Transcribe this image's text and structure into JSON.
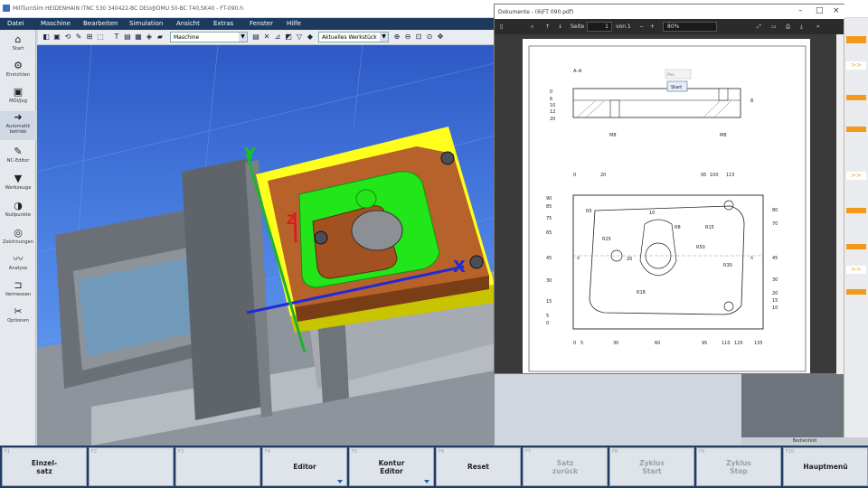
{
  "window_title": "MillTurnSim HEIDENHAIN iTNC 530 340422-BC DEU@DMU 50-BC T40,SK40 - FT-090.h",
  "menu": [
    "Datei",
    "Maschine",
    "Bearbeiten",
    "Simulation",
    "Ansicht",
    "Extras",
    "Fenster",
    "Hilfe"
  ],
  "toolbar": {
    "view_combo": "Maschine",
    "workpiece_combo": "Aktuelles Werkstück"
  },
  "sidebar": [
    {
      "label": "Start",
      "icon": "home-icon"
    },
    {
      "label": "Einrichten",
      "icon": "setup-icon"
    },
    {
      "label": "MDI/Jog",
      "icon": "mdi-jog-icon"
    },
    {
      "label": "Automatik betrieb",
      "icon": "automatic-mode-icon"
    },
    {
      "label": "NC-Editor",
      "icon": "nc-editor-icon"
    },
    {
      "label": "Werkzeuge",
      "icon": "tools-icon"
    },
    {
      "label": "Nullpunkte",
      "icon": "datum-icon"
    },
    {
      "label": "Zeichnungen",
      "icon": "drawings-icon"
    },
    {
      "label": "Analyse",
      "icon": "analysis-icon"
    },
    {
      "label": "Vermessen",
      "icon": "measure-icon"
    },
    {
      "label": "Optionen",
      "icon": "options-icon"
    }
  ],
  "viewport": {
    "axis_x": "X",
    "axis_y": "Y",
    "axis_z": "Z"
  },
  "pdf": {
    "title": "Dokumente - (6\\FT 090.pdf)",
    "page_label": "Seite",
    "page_value": "1",
    "page_of": "von 1",
    "zoom": "80%",
    "popup_field": "Pos.",
    "popup_button": "Start",
    "section_label": "A–A",
    "section_dims": [
      "0",
      "6",
      "10",
      "12",
      "20",
      "8"
    ],
    "callouts": [
      "M8",
      "M8"
    ],
    "top_dims": [
      "0",
      "20",
      "95",
      "100",
      "115"
    ],
    "left_dims": [
      "90",
      "85",
      "75",
      "65",
      "45",
      "30",
      "15",
      "5",
      "0"
    ],
    "right_dims": [
      "80",
      "70",
      "45",
      "30",
      "20",
      "15",
      "10"
    ],
    "bottom_dims": [
      "0",
      "5",
      "30",
      "60",
      "95",
      "110",
      "120",
      "135"
    ],
    "radii": [
      "R5",
      "R8",
      "R15",
      "R50",
      "R30",
      "R18",
      "R25"
    ],
    "inner_dims": [
      "10",
      "20"
    ],
    "section_marks": [
      "A",
      "A"
    ]
  },
  "right_panel": {
    "arrows": [
      ">>",
      ">>",
      ">>",
      ">>",
      ">>"
    ],
    "bedienfeld": "Bedienfeld"
  },
  "softkeys": [
    {
      "num": "F1",
      "label": "Einzel-\nsatz",
      "enabled": true,
      "menu": false
    },
    {
      "num": "F2",
      "label": "",
      "enabled": true,
      "menu": false
    },
    {
      "num": "F3",
      "label": "",
      "enabled": true,
      "menu": false
    },
    {
      "num": "F4",
      "label": "Editor",
      "enabled": true,
      "menu": true
    },
    {
      "num": "F5",
      "label": "Kontur\nEditor",
      "enabled": true,
      "menu": true
    },
    {
      "num": "F6",
      "label": "Reset",
      "enabled": true,
      "menu": false
    },
    {
      "num": "F7",
      "label": "Satz\nzurück",
      "enabled": false,
      "menu": false
    },
    {
      "num": "F8",
      "label": "Zyklus\nStart",
      "enabled": false,
      "menu": false
    },
    {
      "num": "F9",
      "label": "Zyklus\nStop",
      "enabled": false,
      "menu": false
    },
    {
      "num": "F10",
      "label": "Hauptmenü",
      "enabled": true,
      "menu": false
    }
  ],
  "colors": {
    "menubar": "#1b3a5e",
    "accent_orange": "#f39a1b",
    "workpiece_green": "#22e51a",
    "clamp_yellow": "#ffff1e",
    "plate_brown": "#b7622a"
  }
}
